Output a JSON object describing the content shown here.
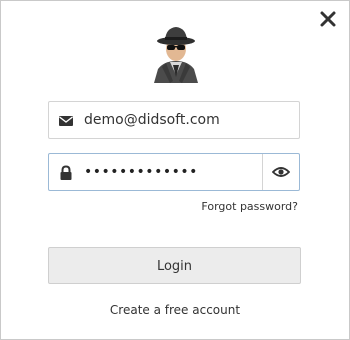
{
  "dialog": {
    "close_icon": "close-icon",
    "avatar_icon": "spy-avatar-icon"
  },
  "email": {
    "icon": "envelope-icon",
    "value": "demo@didsoft.com"
  },
  "password": {
    "icon": "lock-icon",
    "masked_value": "•••••••••••••",
    "toggle_icon": "eye-icon"
  },
  "links": {
    "forgot": "Forgot password?",
    "create_account": "Create a free account"
  },
  "buttons": {
    "login": "Login"
  },
  "colors": {
    "focus_border": "#9bb9d6",
    "button_bg": "#ececec"
  }
}
